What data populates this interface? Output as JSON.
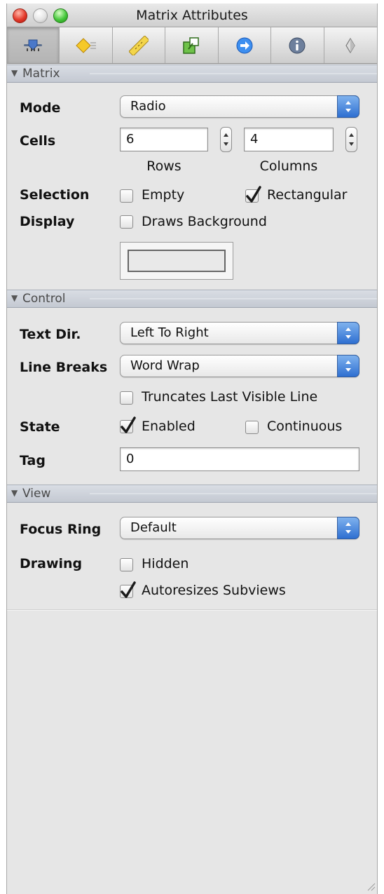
{
  "window": {
    "title": "Matrix Attributes"
  },
  "toolbar": {
    "tabs": [
      {
        "icon": "attributes-slider-icon",
        "selected": true
      },
      {
        "icon": "effects-diamond-icon",
        "selected": false
      },
      {
        "icon": "size-ruler-icon",
        "selected": false
      },
      {
        "icon": "connections-icon",
        "selected": false
      },
      {
        "icon": "bindings-arrow-icon",
        "selected": false
      },
      {
        "icon": "identity-info-icon",
        "selected": false
      },
      {
        "icon": "applescript-icon",
        "selected": false
      }
    ]
  },
  "matrix": {
    "header": "Matrix",
    "mode_label": "Mode",
    "mode_value": "Radio",
    "cells_label": "Cells",
    "rows_value": "6",
    "columns_value": "4",
    "rows_label": "Rows",
    "columns_label": "Columns",
    "selection_label": "Selection",
    "empty_label": "Empty",
    "empty_checked": false,
    "rectangular_label": "Rectangular",
    "rectangular_checked": true,
    "display_label": "Display",
    "draws_background_label": "Draws Background",
    "draws_background_checked": false
  },
  "control": {
    "header": "Control",
    "text_dir_label": "Text Dir.",
    "text_dir_value": "Left To Right",
    "line_breaks_label": "Line Breaks",
    "line_breaks_value": "Word Wrap",
    "truncates_label": "Truncates Last Visible Line",
    "truncates_checked": false,
    "state_label": "State",
    "enabled_label": "Enabled",
    "enabled_checked": true,
    "continuous_label": "Continuous",
    "continuous_checked": false,
    "tag_label": "Tag",
    "tag_value": "0"
  },
  "view": {
    "header": "View",
    "focus_ring_label": "Focus Ring",
    "focus_ring_value": "Default",
    "drawing_label": "Drawing",
    "hidden_label": "Hidden",
    "hidden_checked": false,
    "autoresizes_label": "Autoresizes Subviews",
    "autoresizes_checked": true
  },
  "colors": {
    "accent": "#2e6fd1",
    "section_header": "#c9cdd5",
    "panel_bg": "#e6e6e6"
  }
}
